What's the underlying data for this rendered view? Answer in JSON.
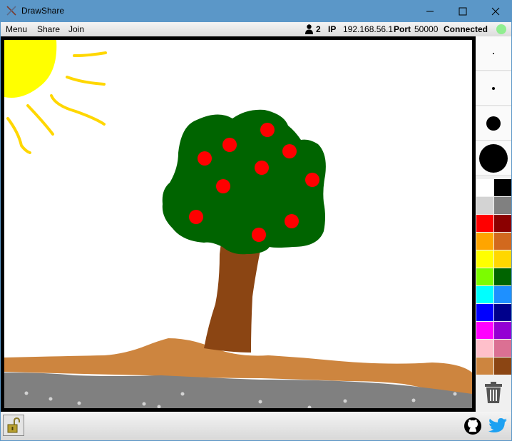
{
  "window": {
    "title": "DrawShare",
    "icon": "drawshare-app-icon",
    "controls": [
      "minimize-icon",
      "maximize-icon",
      "close-icon"
    ]
  },
  "menu": {
    "items": [
      "Menu",
      "Share",
      "Join"
    ]
  },
  "status": {
    "users_icon": "person-icon",
    "users_count": "2",
    "ip_label": "IP",
    "ip_value": "192.168.56.1",
    "port_label": "Port",
    "port_value": "50000",
    "connection": "Connected",
    "indicator_color": "#90ee90"
  },
  "palette": {
    "brush_sizes": [
      "tiny",
      "small",
      "medium",
      "large"
    ],
    "colors": [
      "#ffffff",
      "#000000",
      "#d3d3d3",
      "#808080",
      "#ff0000",
      "#8b0000",
      "#ffa500",
      "#d2691e",
      "#ffff00",
      "#ffd700",
      "#7cfc00",
      "#006400",
      "#00ffff",
      "#1e90ff",
      "#0000ff",
      "#00008b",
      "#ff00ff",
      "#9400d3",
      "#ffc0cb",
      "#db7093",
      "#cd853f",
      "#8b4513"
    ],
    "trash_icon": "trash-icon"
  },
  "drawing": {
    "subject": "tree-with-red-fruit-and-sun",
    "colors": {
      "sun": "#ffff00",
      "rays": "#ffd700",
      "foliage": "#006400",
      "fruit": "#ff0000",
      "trunk": "#8b4513",
      "ground": "#cd853f",
      "road": "#808080",
      "stones": "#d3d3d3"
    }
  },
  "footer": {
    "lock_icon": "unlocked-padlock-icon",
    "github_icon": "github-icon",
    "twitter_icon": "twitter-icon"
  }
}
